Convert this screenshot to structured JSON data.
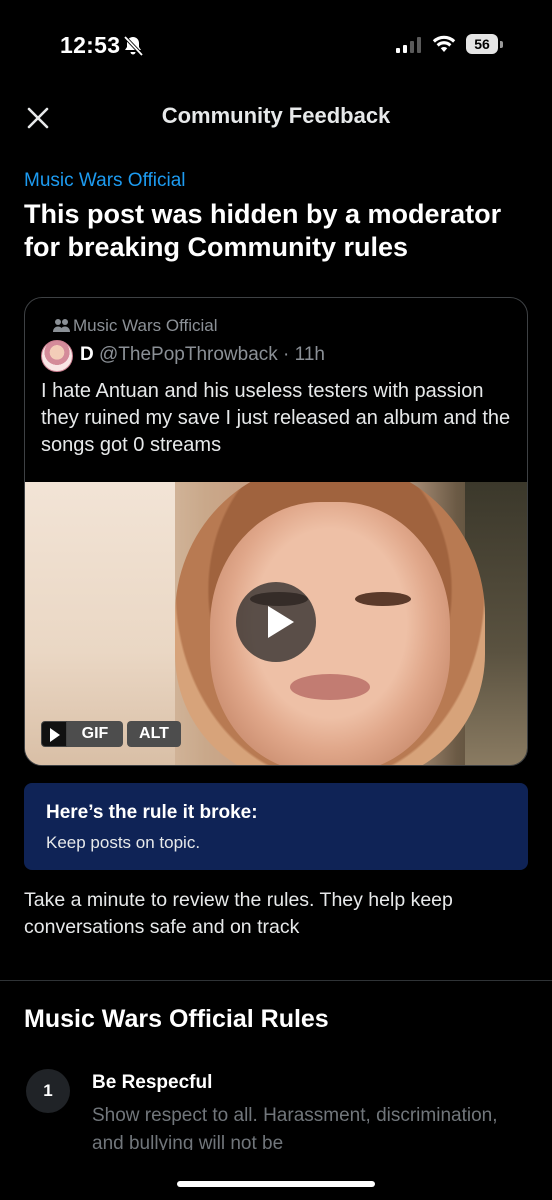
{
  "status_bar": {
    "time": "12:53",
    "battery": "56",
    "icons": [
      "bell-slash-icon",
      "cellular-signal-icon",
      "wifi-icon",
      "battery-icon"
    ]
  },
  "header": {
    "title": "Community Feedback",
    "close_icon": "close-icon"
  },
  "community_name": "Music Wars Official",
  "main_title": "This post was hidden by a moderator for breaking Community rules",
  "post": {
    "community": "Music Wars Official",
    "author_name": "D",
    "author_handle": "@ThePopThrowback · 11h",
    "text": "I hate Antuan and his useless testers with passion they ruined my save I just released an album and the songs got 0 streams",
    "media_badge_gif": "GIF",
    "media_badge_alt": "ALT"
  },
  "rule_box": {
    "heading": "Here’s the rule it broke:",
    "text": "Keep posts on topic."
  },
  "review_text": "Take a minute to review the rules. They help keep conversations safe and on track",
  "rules_section": {
    "title": "Music Wars Official Rules",
    "items": [
      {
        "number": "1",
        "title": "Be Respecful",
        "description": "Show respect to all. Harassment, discrimination, and bullying will not be"
      }
    ]
  },
  "colors": {
    "background": "#000000",
    "accent": "#1d9bf0",
    "rule_box_bg": "#0f2356",
    "muted_text": "#71767b"
  }
}
